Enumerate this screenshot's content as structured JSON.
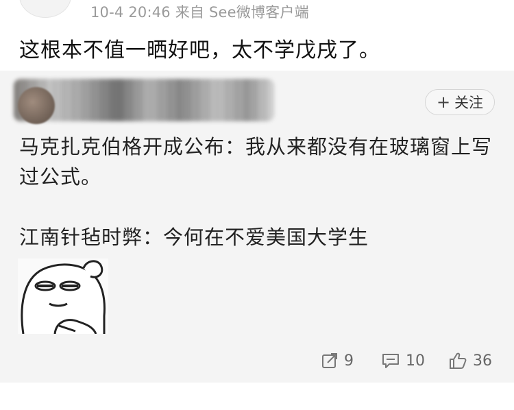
{
  "post": {
    "meta": "10-4 20:46  来自 See微博客户端",
    "text": "这根本不值一晒好吧，太不学戊戌了。"
  },
  "repost": {
    "follow_label": "关注",
    "comments": [
      "马克扎克伯格开成公布：我从来都没有在玻璃窗上写过公式。",
      "江南针毡时弊：今何在不爱美国大学生"
    ],
    "actions": {
      "repost_count": "9",
      "comment_count": "10",
      "like_count": "36"
    }
  },
  "icons": [
    "repost-icon",
    "comment-icon",
    "like-icon",
    "plus-icon"
  ]
}
